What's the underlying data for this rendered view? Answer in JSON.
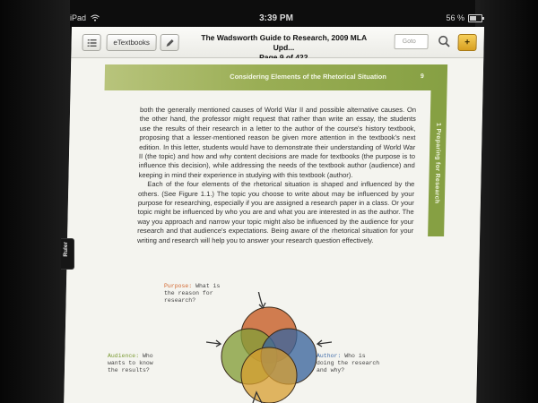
{
  "status_bar": {
    "device": "iPad",
    "time": "3:39 PM",
    "battery": "56 %",
    "battery_level": 0.56
  },
  "toolbar": {
    "etextbooks_label": "eTextbooks",
    "title_line1": "The Wadsworth Guide to Research, 2009 MLA Upd...",
    "title_line2": "Page 9 of 422",
    "goto_placeholder": "Goto",
    "add_label": "+"
  },
  "page": {
    "section_title": "Considering Elements of the Rhetorical Situation",
    "page_number": "9",
    "side_tab": "1 Preparing for Research",
    "paragraph1": "both the generally mentioned causes of World War II and possible alternative causes. On the other hand, the professor might request that rather than write an essay, the students use the results of their research in a letter to the author of the course's history textbook, proposing that a lesser-mentioned reason be given more attention in the textbook's next edition. In this letter, students would have to demonstrate their understanding of World War II (the topic) and how and why content decisions are made for textbooks (the purpose is to influence this decision), while addressing the needs of the textbook author (audience) and keeping in mind their experience in studying with this textbook (author).",
    "paragraph2": "Each of the four elements of the rhetorical situation is shaped and influenced by the others. (See Figure 1.1.) The topic you choose to write about may be influenced by your purpose for researching, especially if you are assigned a research paper in a class. Or your topic might be influenced by who you are and what you are interested in as the author. The way you approach and narrow your topic might also be influenced by the audience for your research and that audience's expectations. Being aware of the rhetorical situation for your writing and research will help you to answer your research question effectively."
  },
  "figure": {
    "purpose_keyword": "Purpose:",
    "purpose_text": " What is the reason for research?",
    "audience_keyword": "Audience:",
    "audience_text": " Who wants to know the results?",
    "author_keyword": "Author:",
    "author_text": " Who is doing the research and why?",
    "colors": {
      "purpose": "#d2662e",
      "audience": "#8aa53c",
      "author": "#3d6aa8",
      "topic": "#e1a533",
      "keyword_orange": "#d2662e",
      "keyword_green": "#7a9a33"
    }
  },
  "ruler_tab": "Ruler",
  "colors": {
    "section_green": "#86a043",
    "add_button": "#e0ab2c"
  },
  "icons": [
    "menu-list-icon",
    "pencil-icon",
    "search-icon",
    "wifi-icon",
    "battery-icon",
    "arrow-icon"
  ]
}
